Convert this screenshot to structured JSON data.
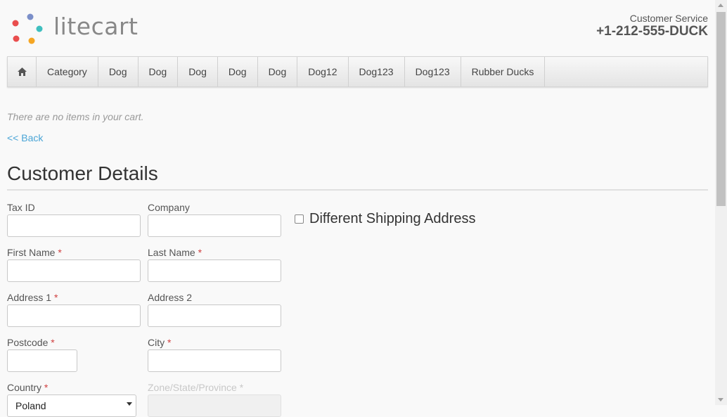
{
  "header": {
    "logo_text": "litecart",
    "customer_service_label": "Customer Service",
    "customer_service_phone": "+1-212-555-DUCK"
  },
  "nav": {
    "home_icon": "home-icon",
    "items": [
      "Category",
      "Dog",
      "Dog",
      "Dog",
      "Dog",
      "Dog",
      "Dog12",
      "Dog123",
      "Dog123",
      "Rubber Ducks"
    ]
  },
  "cart": {
    "empty_message": "There are no items in your cart.",
    "back_link": "<< Back"
  },
  "customer_details": {
    "title": "Customer Details",
    "tax_id_label": "Tax ID",
    "company_label": "Company",
    "first_name_label": "First Name",
    "last_name_label": "Last Name",
    "address1_label": "Address 1",
    "address2_label": "Address 2",
    "postcode_label": "Postcode",
    "city_label": "City",
    "country_label": "Country",
    "country_value": "Poland",
    "zone_label": "Zone/State/Province",
    "required_marker": "*",
    "different_shipping_label": "Different Shipping Address"
  },
  "colors": {
    "link": "#4aa5d6",
    "required": "#d04040",
    "logo_dots": [
      "#7b8fc9",
      "#e94e4e",
      "#3fbfbf",
      "#e94e4e",
      "#f5a623"
    ]
  }
}
